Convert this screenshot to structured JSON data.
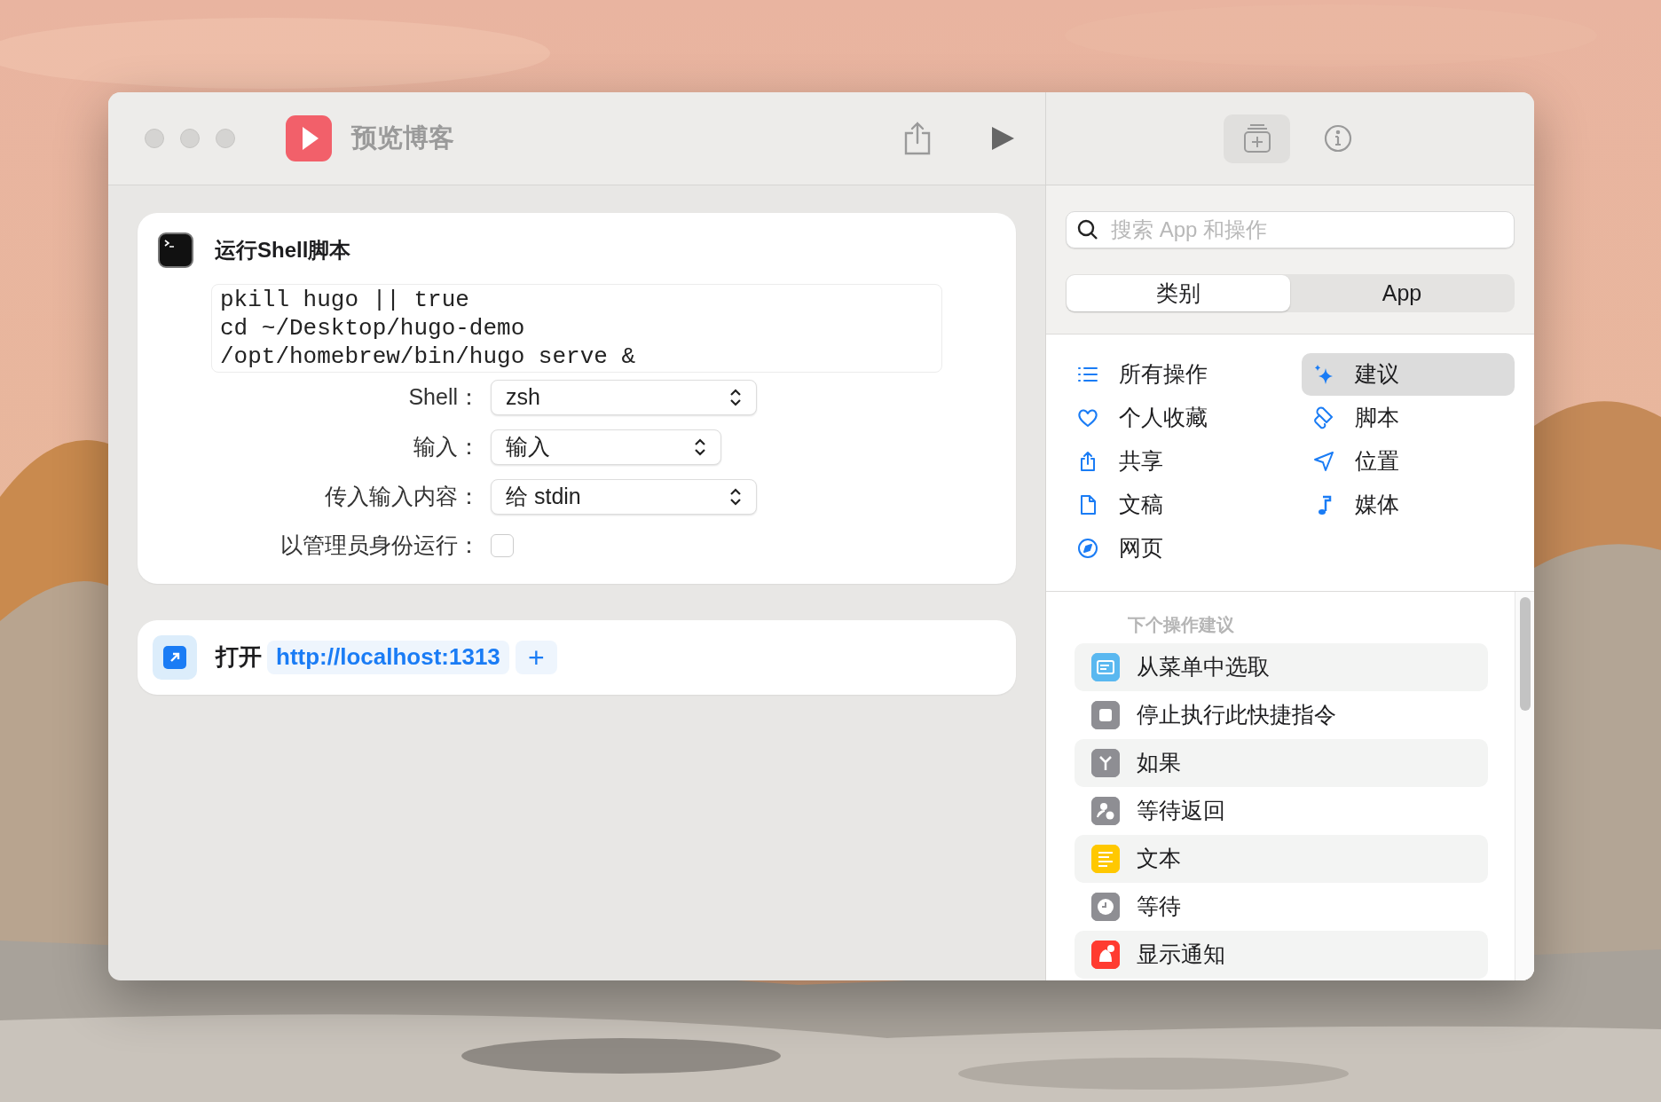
{
  "window": {
    "title": "预览博客"
  },
  "actions": [
    {
      "kind": "shell",
      "title": "运行Shell脚本",
      "script": [
        "pkill hugo || true",
        "cd ~/Desktop/hugo-demo",
        "/opt/homebrew/bin/hugo serve &"
      ],
      "fields": [
        {
          "kind": "select",
          "label": "Shell：",
          "value": "zsh"
        },
        {
          "kind": "select",
          "label": "输入：",
          "value": "输入"
        },
        {
          "kind": "select",
          "label": "传入输入内容：",
          "value": "给 stdin"
        },
        {
          "kind": "checkbox",
          "label": "以管理员身份运行：",
          "checked": false
        }
      ]
    },
    {
      "kind": "open",
      "verb": "打开",
      "url": "http://localhost:1313",
      "add": "+"
    }
  ],
  "library": {
    "search": {
      "placeholder": "搜索 App 和操作"
    },
    "segments": [
      {
        "label": "类别",
        "selected": true
      },
      {
        "label": "App",
        "selected": false
      }
    ],
    "categories_left": [
      {
        "label": "所有操作",
        "selected": false
      },
      {
        "label": "个人收藏",
        "selected": false
      },
      {
        "label": "共享",
        "selected": false
      },
      {
        "label": "文稿",
        "selected": false
      },
      {
        "label": "网页",
        "selected": false
      }
    ],
    "categories_right": [
      {
        "label": "建议",
        "selected": true
      },
      {
        "label": "脚本",
        "selected": false
      },
      {
        "label": "位置",
        "selected": false
      },
      {
        "label": "媒体",
        "selected": false
      }
    ],
    "suggestions_title": "下个操作建议",
    "suggestions": [
      {
        "label": "从菜单中选取",
        "color": "#5ab8f0"
      },
      {
        "label": "停止执行此快捷指令",
        "color": "#8e8e93"
      },
      {
        "label": "如果",
        "color": "#8e8e93"
      },
      {
        "label": "等待返回",
        "color": "#8e8e93"
      },
      {
        "label": "文本",
        "color": "#ffc800"
      },
      {
        "label": "等待",
        "color": "#8e8e93"
      },
      {
        "label": "显示通知",
        "color": "#ff3b30"
      }
    ]
  }
}
